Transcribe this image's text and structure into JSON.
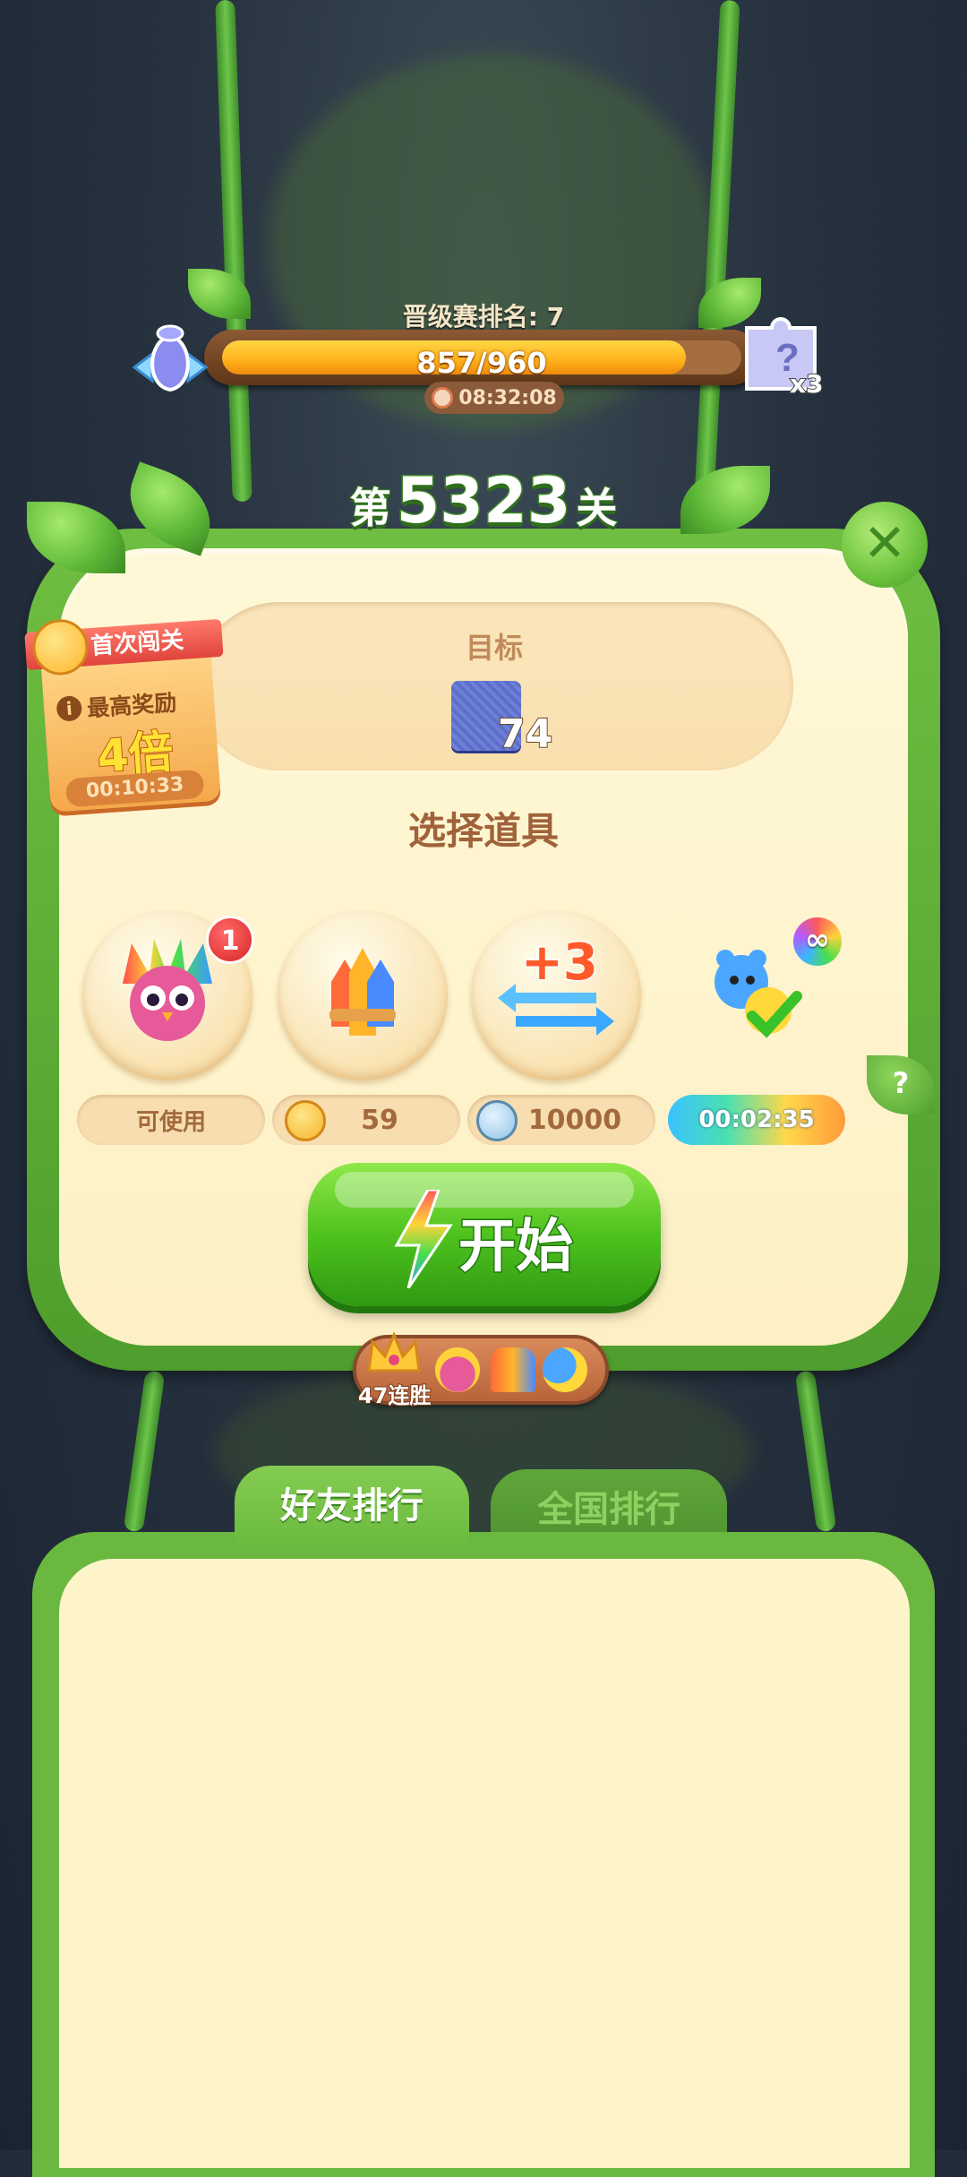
{
  "rank": {
    "label": "晋级赛排名: 7"
  },
  "progress": {
    "text": "857/960",
    "current": 857,
    "max": 960,
    "timer": "08:32:08",
    "reward_multiplier": "x3"
  },
  "level": {
    "prefix": "第",
    "number": "5323",
    "suffix": "关"
  },
  "goal": {
    "label": "目标",
    "count": "74"
  },
  "first_clear": {
    "ribbon": "首次闯关",
    "info": "最高奖励",
    "multiplier": "4倍",
    "timer": "00:10:33"
  },
  "select_title": "选择道具",
  "boosters": [
    {
      "name": "owl-booster",
      "badge": "1",
      "status": "可使用"
    },
    {
      "name": "rocket-booster",
      "price": "59"
    },
    {
      "name": "plus3-moves-booster",
      "icon_text": "+3",
      "price": "10000"
    },
    {
      "name": "animal-booster",
      "infinity": "∞",
      "timer": "00:02:35"
    }
  ],
  "help": "?",
  "start_label": "开始",
  "streak": {
    "label": "47连胜"
  },
  "tabs": {
    "friends": "好友排行",
    "national": "全国排行"
  },
  "close": "✕",
  "colors": {
    "accent_green": "#4fc21e",
    "bar_orange": "#ffb11b",
    "panel_cream": "#fff8d8"
  }
}
